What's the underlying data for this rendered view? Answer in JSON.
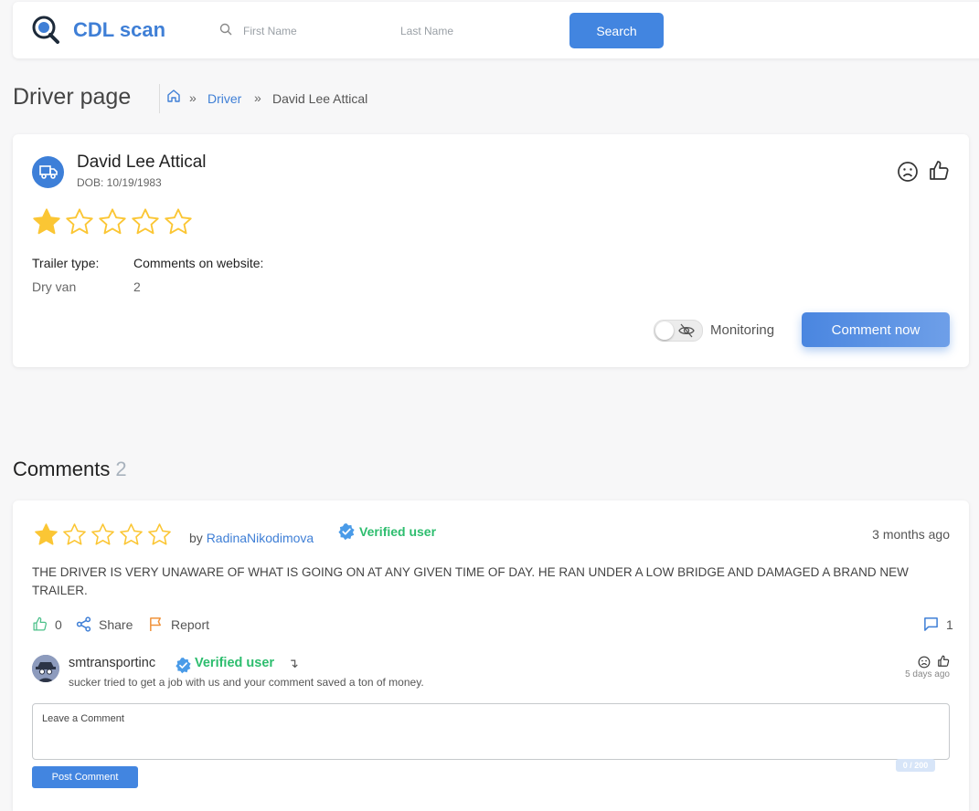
{
  "header": {
    "logo_text": "CDL scan",
    "first_name_placeholder": "First Name",
    "last_name_placeholder": "Last Name",
    "search_label": "Search"
  },
  "breadcrumb": {
    "page_title": "Driver page",
    "link": "Driver",
    "separator": "»",
    "current": "David Lee Attical"
  },
  "driver": {
    "name": "David Lee Attical",
    "dob": "DOB: 10/19/1983",
    "rating": 1,
    "rating_max": 5,
    "trailer_label": "Trailer type:",
    "trailer_value": "Dry van",
    "comments_label": "Comments on website:",
    "comments_value": "2",
    "monitoring_label": "Monitoring",
    "monitoring_on": false,
    "comment_now_label": "Comment now"
  },
  "comments": {
    "title": "Comments",
    "count": "2",
    "items": [
      {
        "rating": 1,
        "by_prefix": "by",
        "user": "RadinaNikodimova",
        "verified": "Verified user",
        "time": "3 months ago",
        "text": "THE DRIVER IS VERY UNAWARE OF WHAT IS GOING ON AT ANY GIVEN TIME OF DAY. HE RAN UNDER A LOW BRIDGE AND DAMAGED A BRAND NEW TRAILER.",
        "likes": "0",
        "share_label": "Share",
        "report_label": "Report",
        "reply_count": "1",
        "reply": {
          "user": "smtransportinc",
          "verified": "Verified user",
          "arrow": "↴",
          "text": "sucker tried to get a job with us and your comment saved a ton of money.",
          "time": "5 days ago"
        }
      }
    ],
    "leave_placeholder": "Leave a Comment",
    "counter": "0 / 200",
    "post_label": "Post Comment"
  },
  "colors": {
    "accent": "#4285e0",
    "verified": "#2dbd6e",
    "star": "#fbc634",
    "report": "#f0923a",
    "like": "#4cc08a"
  }
}
